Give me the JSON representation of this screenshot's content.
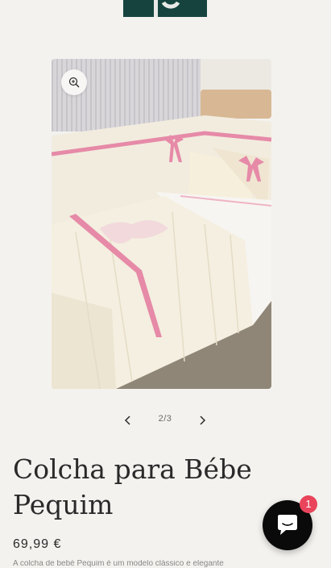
{
  "product": {
    "title": "Colcha para Bébe Pequim",
    "price": "69,99 €",
    "description_peek": "A colcha de bebé Pequim é um modelo clássico e elegante"
  },
  "gallery": {
    "counter": "2/3",
    "image_alt": "Colcha para Bébe Pequim em cama de bebé"
  },
  "chat": {
    "badge_count": "1"
  },
  "colors": {
    "background": "#f3f2ef",
    "logo": "#16433e",
    "chat_button": "#0a0a0a",
    "badge": "#e9445b",
    "ribbon_pink": "#e68aa8"
  }
}
